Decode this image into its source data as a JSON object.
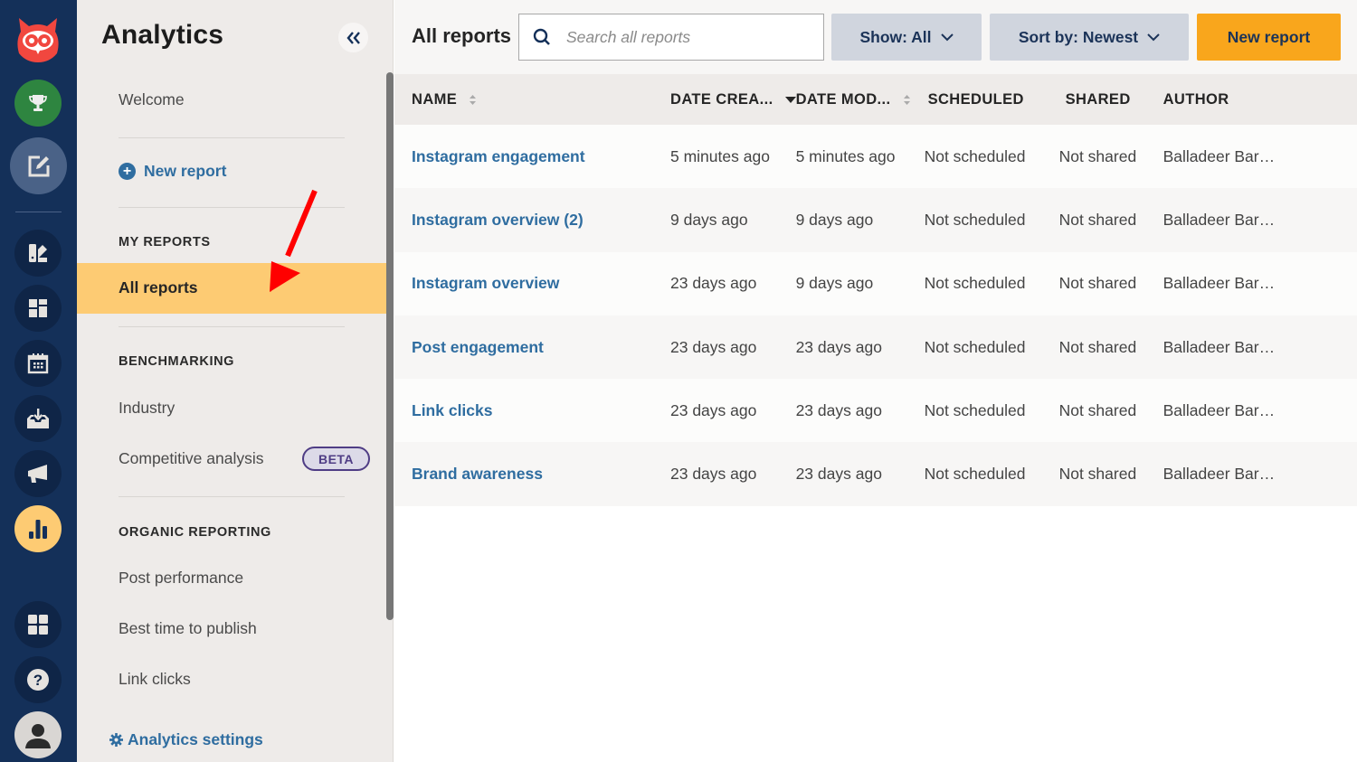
{
  "rail": {
    "items": [
      {
        "name": "hootsuite-logo",
        "icon": "owl-logo"
      },
      {
        "name": "achievements",
        "icon": "trophy-icon",
        "color": "#2e8540"
      },
      {
        "name": "compose",
        "icon": "compose-icon"
      },
      {
        "name": "streams",
        "icon": "streams-icon"
      },
      {
        "name": "dashboard",
        "icon": "dashboard-icon"
      },
      {
        "name": "planner",
        "icon": "calendar-icon"
      },
      {
        "name": "inbox",
        "icon": "inbox-icon"
      },
      {
        "name": "advertise",
        "icon": "megaphone-icon"
      },
      {
        "name": "analytics",
        "icon": "bar-chart-icon",
        "active": true,
        "color": "#fdcb73"
      },
      {
        "name": "apps",
        "icon": "apps-grid-icon"
      },
      {
        "name": "help",
        "icon": "help-icon"
      },
      {
        "name": "profile",
        "icon": "avatar-icon"
      }
    ]
  },
  "sidebar": {
    "title": "Analytics",
    "collapse_icon": "double-chevron-left-icon",
    "welcome": "Welcome",
    "new_report": "New report",
    "sections": {
      "my_reports": "MY REPORTS",
      "benchmarking": "BENCHMARKING",
      "organic_reporting": "ORGANIC REPORTING"
    },
    "items": {
      "all_reports": "All reports",
      "industry": "Industry",
      "competitive_analysis": "Competitive analysis",
      "post_performance": "Post performance",
      "best_time": "Best time to publish",
      "link_clicks": "Link clicks"
    },
    "beta_badge": "BETA",
    "settings": "Analytics settings"
  },
  "main": {
    "title": "All reports",
    "search": {
      "placeholder": "Search all reports",
      "value": ""
    },
    "show_filter": "Show: All",
    "sort_filter": "Sort by: Newest",
    "new_report_button": "New report",
    "table": {
      "columns": [
        "NAME",
        "DATE CREA...",
        "DATE MOD...",
        "SCHEDULED",
        "SHARED",
        "AUTHOR"
      ],
      "sorted_column": "DATE CREA...",
      "sort_direction": "descending",
      "rows": [
        {
          "name": "Instagram engagement",
          "created": "5 minutes ago",
          "modified": "5 minutes ago",
          "scheduled": "Not scheduled",
          "shared": "Not shared",
          "author": "Balladeer Bar…"
        },
        {
          "name": "Instagram overview (2)",
          "created": "9 days ago",
          "modified": "9 days ago",
          "scheduled": "Not scheduled",
          "shared": "Not shared",
          "author": "Balladeer Bar…"
        },
        {
          "name": "Instagram overview",
          "created": "23 days ago",
          "modified": "9 days ago",
          "scheduled": "Not scheduled",
          "shared": "Not shared",
          "author": "Balladeer Bar…"
        },
        {
          "name": "Post engagement",
          "created": "23 days ago",
          "modified": "23 days ago",
          "scheduled": "Not scheduled",
          "shared": "Not shared",
          "author": "Balladeer Bar…"
        },
        {
          "name": "Link clicks",
          "created": "23 days ago",
          "modified": "23 days ago",
          "scheduled": "Not scheduled",
          "shared": "Not shared",
          "author": "Balladeer Bar…"
        },
        {
          "name": "Brand awareness",
          "created": "23 days ago",
          "modified": "23 days ago",
          "scheduled": "Not scheduled",
          "shared": "Not shared",
          "author": "Balladeer Bar…"
        }
      ]
    }
  },
  "colors": {
    "rail_bg": "#143059",
    "accent_link": "#2f6da0",
    "active_item": "#fdcb73",
    "primary_button": "#f9a61c",
    "annotation_arrow": "#ff0000"
  }
}
